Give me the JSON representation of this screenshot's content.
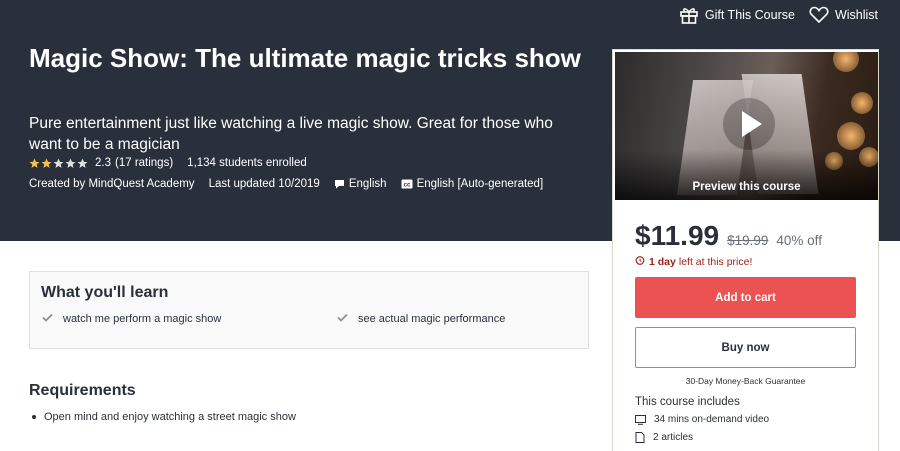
{
  "top_links": {
    "gift": "Gift This Course",
    "wishlist": "Wishlist"
  },
  "course": {
    "title": "Magic Show: The ultimate magic tricks show",
    "subtitle": "Pure entertainment just like watching a live magic show. Great for those who want to be a magician",
    "rating_value": "2.3",
    "rating_count": "(17 ratings)",
    "rating_stars": 2.3,
    "students": "1,134 students enrolled",
    "created_by": "Created by MindQuest Academy",
    "last_updated": "Last updated 10/2019",
    "language": "English",
    "captions": "English [Auto-generated]"
  },
  "card": {
    "preview_label": "Preview this course",
    "price": "$11.99",
    "old_price": "$19.99",
    "discount": "40% off",
    "timer_bold": "1 day",
    "timer_rest": "left at this price!",
    "add_to_cart": "Add to cart",
    "buy_now": "Buy now",
    "guarantee": "30-Day Money-Back Guarantee",
    "includes_title": "This course includes",
    "includes": [
      "34 mins on-demand video",
      "2 articles"
    ]
  },
  "learn": {
    "title": "What you'll learn",
    "items": [
      "watch me perform a magic show",
      "see actual magic performance"
    ]
  },
  "requirements": {
    "title": "Requirements",
    "items": [
      "Open mind and enjoy watching a street magic show"
    ]
  },
  "colors": {
    "header_bg": "#29303b",
    "accent": "#ec5252",
    "star": "#f4c150",
    "timer": "#9a1f16"
  }
}
